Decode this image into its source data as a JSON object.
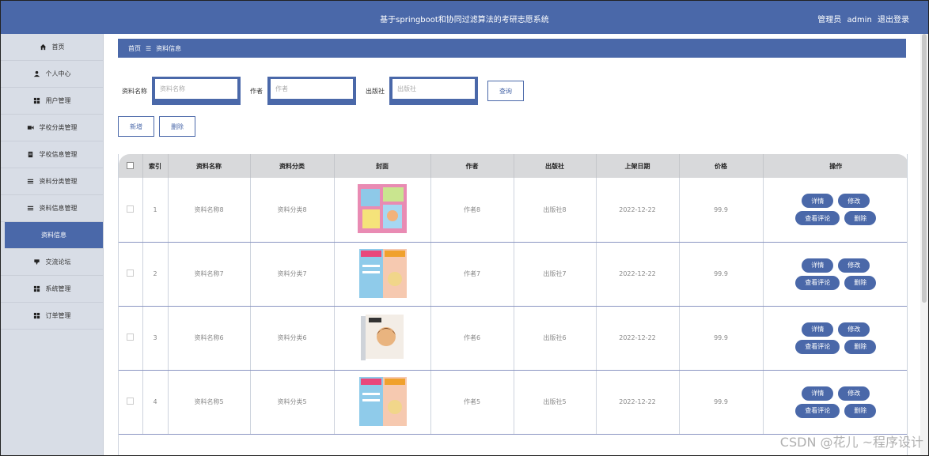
{
  "app": {
    "title": "基于springboot和协同过滤算法的考研志愿系统"
  },
  "user": {
    "role": "管理员",
    "name": "admin",
    "logout": "退出登录"
  },
  "sidebar": {
    "items": [
      {
        "label": "首页",
        "icon": "home-icon",
        "active": false
      },
      {
        "label": "个人中心",
        "icon": "user-icon",
        "active": false
      },
      {
        "label": "用户管理",
        "icon": "grid-icon",
        "active": false
      },
      {
        "label": "学校分类管理",
        "icon": "video-icon",
        "active": false
      },
      {
        "label": "学校信息管理",
        "icon": "document-icon",
        "active": false
      },
      {
        "label": "资料分类管理",
        "icon": "list-icon",
        "active": false
      },
      {
        "label": "资料信息管理",
        "icon": "list-icon",
        "active": false
      },
      {
        "label": "资料信息",
        "icon": "",
        "active": true
      },
      {
        "label": "交流论坛",
        "icon": "forum-icon",
        "active": false
      },
      {
        "label": "系统管理",
        "icon": "grid-icon",
        "active": false
      },
      {
        "label": "订单管理",
        "icon": "grid-icon",
        "active": false
      }
    ]
  },
  "breadcrumb": {
    "home": "首页",
    "sep": "☰",
    "current": "资料信息"
  },
  "search": {
    "name_label": "资料名称",
    "name_placeholder": "资料名称",
    "author_label": "作者",
    "author_placeholder": "作者",
    "publisher_label": "出版社",
    "publisher_placeholder": "出版社",
    "query_button": "查询"
  },
  "actions": {
    "add": "新增",
    "delete": "删除"
  },
  "table": {
    "columns": [
      "",
      "索引",
      "资料名称",
      "资料分类",
      "封面",
      "作者",
      "出版社",
      "上架日期",
      "价格",
      "操作"
    ],
    "rows": [
      {
        "index": "1",
        "name": "资料名称8",
        "category": "资料分类8",
        "author": "作者8",
        "publisher": "出版社8",
        "date": "2022-12-22",
        "price": "99.9"
      },
      {
        "index": "2",
        "name": "资料名称7",
        "category": "资料分类7",
        "author": "作者7",
        "publisher": "出版社7",
        "date": "2022-12-22",
        "price": "99.9"
      },
      {
        "index": "3",
        "name": "资料名称6",
        "category": "资料分类6",
        "author": "作者6",
        "publisher": "出版社6",
        "date": "2022-12-22",
        "price": "99.9"
      },
      {
        "index": "4",
        "name": "资料名称5",
        "category": "资料分类5",
        "author": "作者5",
        "publisher": "出版社5",
        "date": "2022-12-22",
        "price": "99.9"
      }
    ],
    "row_buttons": {
      "detail": "详情",
      "edit": "修改",
      "comments": "查看评论",
      "delete": "删除"
    }
  },
  "colors": {
    "primary": "#4a68a9",
    "sidebar_bg": "#d8dde6",
    "header_row": "#d8d9db"
  },
  "watermark": "CSDN @花儿 ~程序设计"
}
